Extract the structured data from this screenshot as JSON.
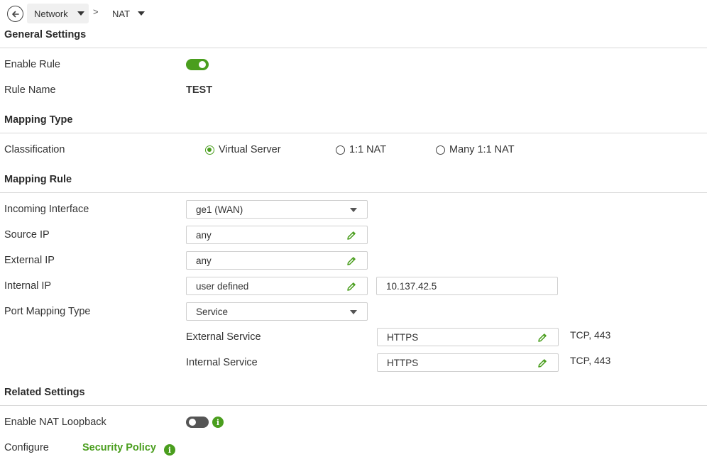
{
  "breadcrumb": {
    "network": "Network",
    "separator": ">",
    "nat": "NAT"
  },
  "general": {
    "title": "General Settings",
    "enable_rule_label": "Enable Rule",
    "enable_rule_on": true,
    "rule_name_label": "Rule Name",
    "rule_name_value": "TEST"
  },
  "mapping_type": {
    "title": "Mapping Type",
    "classification_label": "Classification",
    "options": [
      "Virtual Server",
      "1:1 NAT",
      "Many 1:1 NAT"
    ],
    "selected": "Virtual Server"
  },
  "mapping_rule": {
    "title": "Mapping Rule",
    "incoming_interface_label": "Incoming Interface",
    "incoming_interface_value": "ge1 (WAN)",
    "source_ip_label": "Source IP",
    "source_ip_value": "any",
    "external_ip_label": "External IP",
    "external_ip_value": "any",
    "internal_ip_label": "Internal IP",
    "internal_ip_value": "user defined",
    "internal_ip_address": "10.137.42.5",
    "port_mapping_type_label": "Port Mapping Type",
    "port_mapping_type_value": "Service",
    "external_service_label": "External Service",
    "external_service_value": "HTTPS",
    "external_service_detail": "TCP, 443",
    "internal_service_label": "Internal Service",
    "internal_service_value": "HTTPS",
    "internal_service_detail": "TCP, 443"
  },
  "related": {
    "title": "Related Settings",
    "nat_loopback_label": "Enable NAT Loopback",
    "nat_loopback_on": false,
    "configure_label": "Configure",
    "security_policy_link": "Security Policy"
  },
  "icons": {
    "info": "i"
  },
  "colors": {
    "accent": "#4a9e1e",
    "toggle_off": "#555555",
    "divider": "#d9d9d9"
  }
}
